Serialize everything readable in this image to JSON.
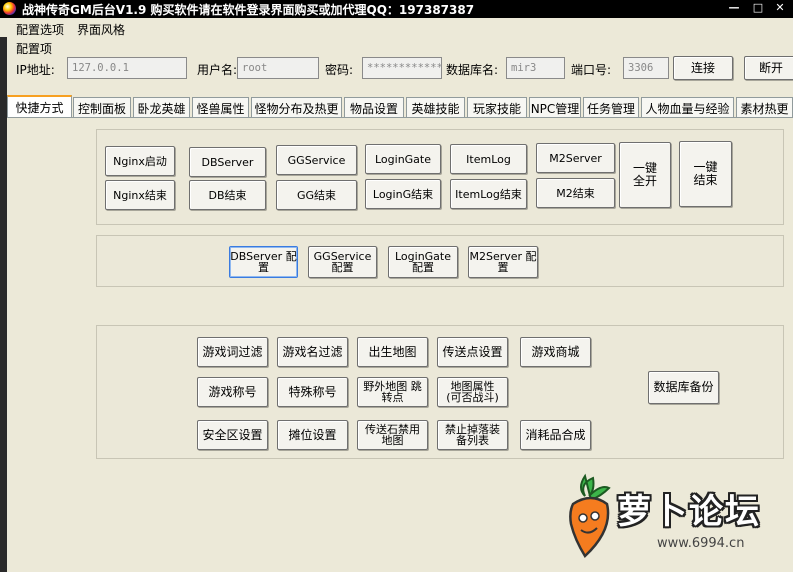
{
  "window": {
    "title": "战神传奇GM后台V1.9    购买软件请在软件登录界面购买或加代理QQ：197387387",
    "controls": {
      "minimize": "—",
      "maximize": "□",
      "close": "✕"
    }
  },
  "menu": [
    "配置选项",
    "界面风格"
  ],
  "config": {
    "group_label": "配置项",
    "ip_label": "IP地址:",
    "ip_value": "127.0.0.1",
    "user_label": "用户名:",
    "user_value": "root",
    "pwd_label": "密码:",
    "pwd_value": "*************",
    "db_label": "数据库名:",
    "db_value": "mir3",
    "port_label": "端口号:",
    "port_value": "3306",
    "connect_label": "连接",
    "disconnect_label": "断开"
  },
  "tabs": [
    "快捷方式",
    "控制面板",
    "卧龙英雄",
    "怪兽属性",
    "怪物分布及热更",
    "物品设置",
    "英雄技能",
    "玩家技能",
    "NPC管理",
    "任务管理",
    "人物血量与经验",
    "素材热更"
  ],
  "active_tab": 0,
  "services": {
    "nginx_start": "Nginx启动",
    "dbserver": "DBServer",
    "ggservice": "GGService",
    "logingate": "LoginGate",
    "itemlog": "ItemLog",
    "m2server": "M2Server",
    "nginx_stop": "Nginx结束",
    "db_stop": "DB结束",
    "gg_stop": "GG结束",
    "loging_stop": "LoginG结束",
    "itemlog_stop": "ItemLog结束",
    "m2_stop": "M2结束",
    "start_all": "一键\n全开",
    "stop_all": "一键\n结束"
  },
  "configs": {
    "dbserver_cfg": "DBServer 配\n置",
    "ggservice_cfg": "GGService\n配置",
    "logingate_cfg": "LoginGate\n配置",
    "m2server_cfg": "M2Server 配\n置"
  },
  "tools": {
    "word_filter": "游戏词过滤",
    "name_filter": "游戏名过滤",
    "birth_map": "出生地图",
    "teleport_settings": "传送点设置",
    "game_shop": "游戏商城",
    "game_title": "游戏称号",
    "special_title": "特殊称号",
    "wild_map_jump": "野外地图 跳\n转点",
    "map_attr": "地图属性\n(可否战斗)",
    "safe_zone": "安全区设置",
    "stall_settings": "摊位设置",
    "teleport_stone_ban": "传送石禁用\n地图",
    "drop_ban_list": "禁止掉落装\n备列表",
    "consumable_craft": "消耗品合成",
    "db_backup": "数据库备份"
  },
  "watermark": {
    "text": "萝卜论坛",
    "url": "www.6994.cn"
  }
}
